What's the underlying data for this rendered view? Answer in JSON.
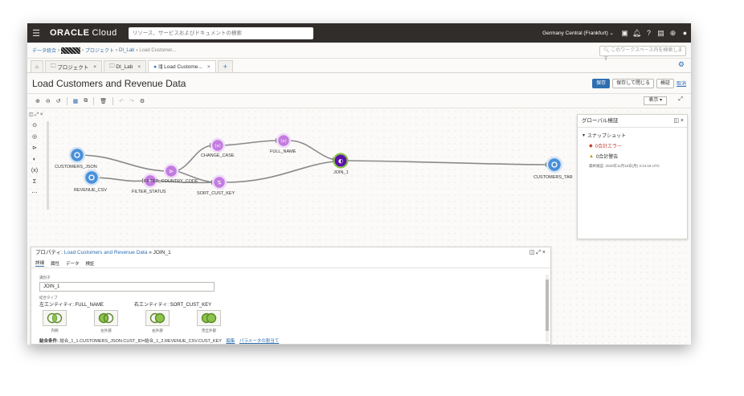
{
  "topbar": {
    "menu_icon": "hamburger-icon",
    "brand_main": "ORACLE",
    "brand_sub": "Cloud",
    "search_placeholder": "リソース、サービスおよびドキュメントの検索",
    "region": "Germany Central (Frankfurt) ⌄",
    "icons": [
      "terminal-icon",
      "bell-icon",
      "help-icon",
      "chat-icon",
      "globe-icon",
      "user-icon"
    ]
  },
  "breadcrumb": {
    "item1": "データ統合",
    "item3": "プロジェクト",
    "item4": "DI_Lab",
    "item5": "Load Customer..."
  },
  "workspace_search_placeholder": "このワークスペース内を検索します",
  "tabs": [
    {
      "label": "プロジェクト"
    },
    {
      "label": "DI_Lab"
    },
    {
      "label": "Load Custome..."
    }
  ],
  "title": "Load Customers and Revenue Data",
  "actions": {
    "save": "保存",
    "save_close": "保存して閉じる",
    "validate": "検証",
    "close": "取消"
  },
  "toolbar": {
    "view": "表示 ▾"
  },
  "nodes": {
    "customers_json": "CUSTOMERS_JSON",
    "revenue_csv": "REVENUE_CSV",
    "filter_country_code": "FILTER_COUNTRY_CODE",
    "filter_status": "FILTER_STATUS",
    "change_case": "CHANGE_CASE",
    "sort_cust_key": "SORT_CUST_KEY",
    "full_name": "FULL_NAME",
    "join_1": "JOIN_1",
    "customers_tar": "CUSTOMERS_TAR"
  },
  "validation": {
    "title": "グローバル検証",
    "snapshot": "スナップショット",
    "errors": "0合計エラー",
    "warnings": "0合計警告",
    "timestamp": "最終検証: 2020年11月16日(月) 3:24:16 UTC"
  },
  "properties": {
    "header_prefix": "プロパティ:",
    "header_link": "Load Customers and Revenue Data",
    "header_node": "» JOIN_1",
    "tabs": [
      "詳細",
      "属性",
      "データ",
      "検証"
    ],
    "identifier_label": "識別子",
    "identifier_value": "JOIN_1",
    "join_type_label": "結合タイプ",
    "left_entity": "左エンティティ: FULL_NAME",
    "right_entity": "右エンティティ: SORT_CUST_KEY",
    "join_types": [
      "内側",
      "左外部",
      "右外部",
      "完全外部"
    ],
    "join_condition_label": "結合条件:",
    "join_condition_value": "結合_1_1.CUSTOMERS_JSON.CUST_ID=結合_1_2.REVENUE_CSV.CUST_KEY",
    "edit_link": "編集",
    "assign_param_link": "パラメータの割当て"
  },
  "colors": {
    "source": "#4a90d9",
    "transform": "#c37be0",
    "join": "#6a1fb0",
    "accent": "#2f6fb0"
  }
}
